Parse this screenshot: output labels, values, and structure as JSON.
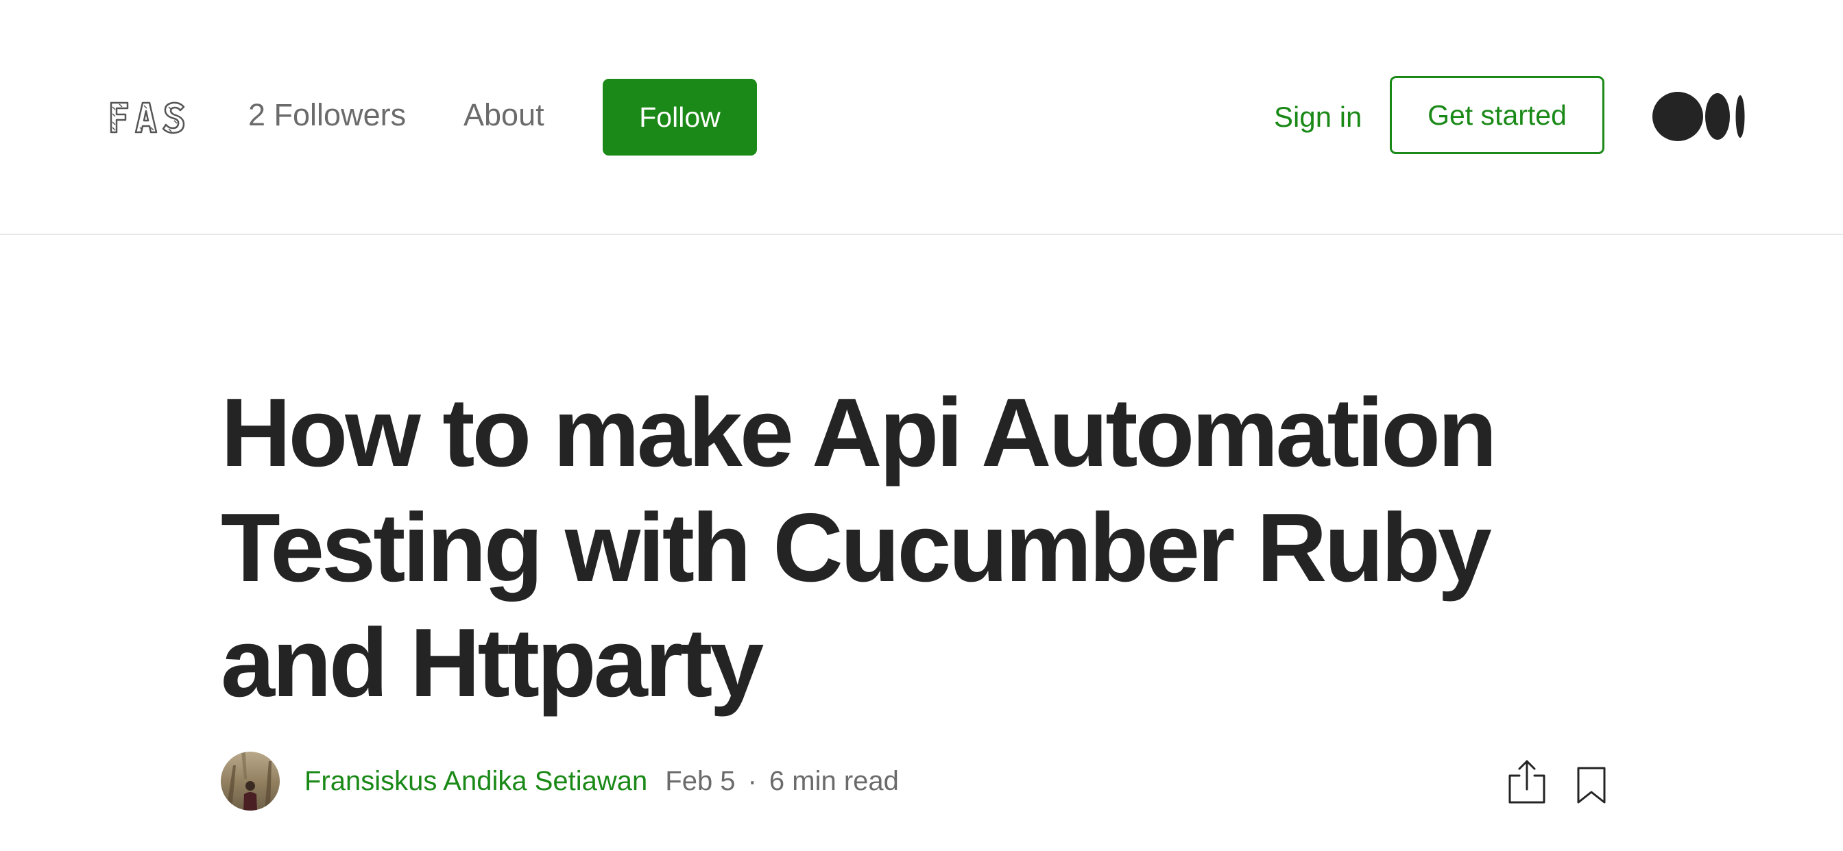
{
  "header": {
    "logo_text": "FAS",
    "followers_label": "2 Followers",
    "about_label": "About",
    "follow_label": "Follow",
    "sign_in_label": "Sign in",
    "get_started_label": "Get started",
    "site_logo_icon": "medium-logo-icon"
  },
  "article": {
    "title": "How to make Api Automation Testing with Cucumber Ruby and Httparty",
    "author": "Fransiskus Andika Setiawan",
    "date": "Feb 5",
    "separator": "·",
    "read_time": "6 min read",
    "share_icon": "share-icon",
    "bookmark_icon": "bookmark-icon"
  },
  "colors": {
    "accent": "#1a8917",
    "text": "#242424",
    "muted": "#6b6b6b",
    "divider": "#e6e6e6"
  }
}
